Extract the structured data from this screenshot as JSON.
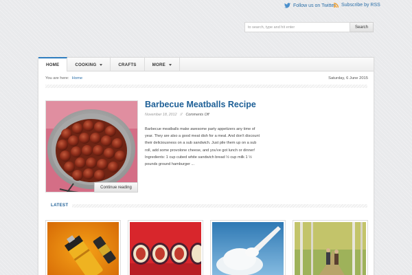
{
  "topbar": {
    "twitter_label": "Follow us on Twitter",
    "rss_label": "Subscribe by RSS"
  },
  "search": {
    "placeholder": "to search, type and hit enter",
    "button_label": "Search"
  },
  "nav": {
    "items": [
      {
        "label": "HOME",
        "active": true,
        "has_dropdown": false
      },
      {
        "label": "COOKING",
        "active": false,
        "has_dropdown": true
      },
      {
        "label": "CRAFTS",
        "active": false,
        "has_dropdown": false
      },
      {
        "label": "MORE",
        "active": false,
        "has_dropdown": true
      }
    ]
  },
  "breadcrumb": {
    "prefix": "You are here:",
    "current": "Home"
  },
  "date": "Saturday, 6 June 2015",
  "featured": {
    "title": "Barbecue Meatballs Recipe",
    "date": "November 18, 2012",
    "separator": "//",
    "comments": "Comments Off",
    "excerpt": "Barbecue meatballs make awesome party appetizers any time of year. They are also a good meat dish for a meal. And don't discount their deliciousness on a sub sandwich. Just pile them up on a sub roll, add some provolone cheese, and you've got lunch or dinner! Ingredients: 1 cup cubed white sandwich bread ½ cup milk 1 ½ pounds ground hamburger ...",
    "continue_label": "Continue reading"
  },
  "latest": {
    "label": "LATEST"
  },
  "colors": {
    "accent": "#2e7dbf",
    "link": "#1d5f96"
  }
}
